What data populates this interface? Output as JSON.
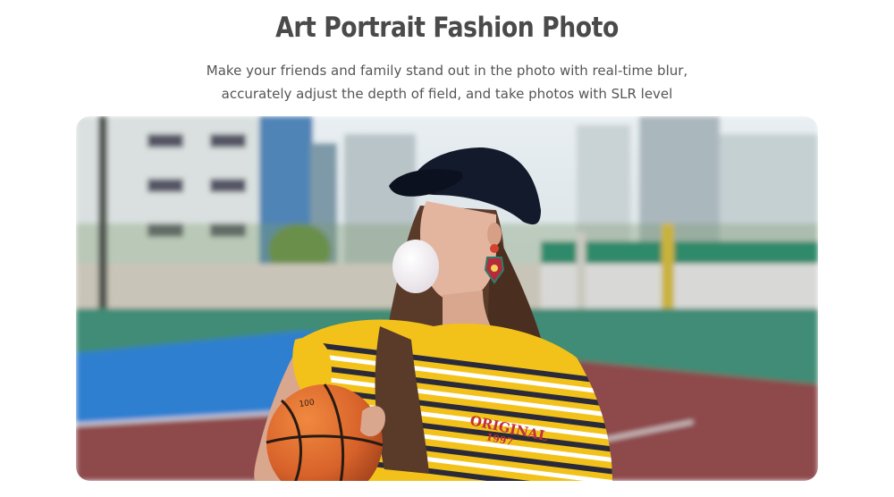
{
  "header": {
    "title": "Art Portrait Fashion Photo",
    "subtitle_line1": "Make your friends and family stand out in the photo with real-time blur,",
    "subtitle_line2": "accurately adjust the depth of field, and take photos with SLR level"
  },
  "photo": {
    "shirt_text": "ORIGINAL",
    "shirt_number": "1997",
    "ball_text": "100"
  }
}
